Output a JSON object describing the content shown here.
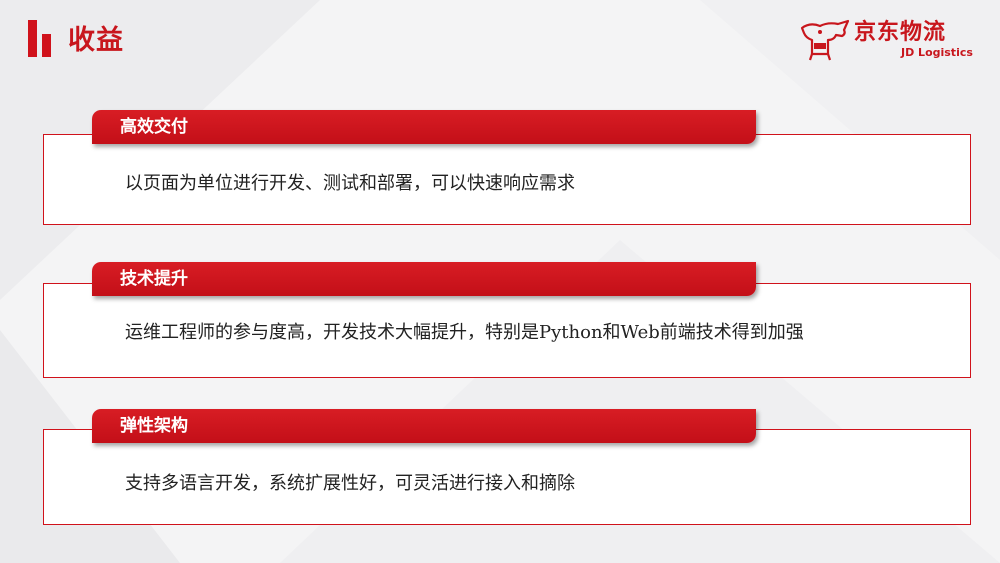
{
  "header": {
    "title": "收益"
  },
  "logo": {
    "name_cn": "京东物流",
    "name_en": "JD Logistics"
  },
  "benefits": [
    {
      "tag": "高效交付",
      "description": "以页面为单位进行开发、测试和部署，可以快速响应需求"
    },
    {
      "tag": "技术提升",
      "description": "运维工程师的参与度高，开发技术大幅提升，特别是Python和Web前端技术得到加强"
    },
    {
      "tag": "弹性架构",
      "description": "支持多语言开发，系统扩展性好，可灵活进行接入和摘除"
    }
  ],
  "colors": {
    "brand_red": "#c8161d",
    "tag_red": "#d0121b",
    "background": "#f4f4f5"
  }
}
